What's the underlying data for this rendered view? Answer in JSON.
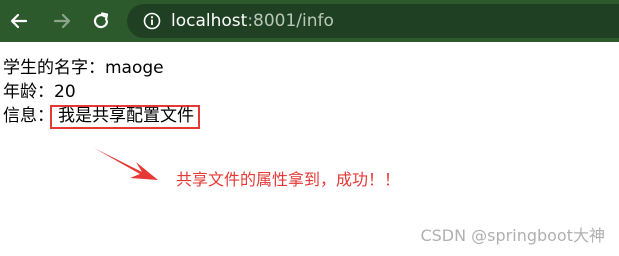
{
  "browser": {
    "url_host": "localhost",
    "url_rest": ":8001/info",
    "toolbar_color": "#2d5a2d"
  },
  "icons": {
    "back": "arrow-left-icon",
    "forward": "arrow-right-icon",
    "reload": "reload-icon",
    "info": "info-icon"
  },
  "page": {
    "name_label": "学生的名字：",
    "name_value": "maoge",
    "age_label": "年龄：",
    "age_value": "20",
    "info_label": "信息：",
    "info_value": "我是共享配置文件"
  },
  "annotation": {
    "text": "共享文件的属性拿到，成功！！",
    "color": "#e53935"
  },
  "watermark": "CSDN @springboot大神"
}
